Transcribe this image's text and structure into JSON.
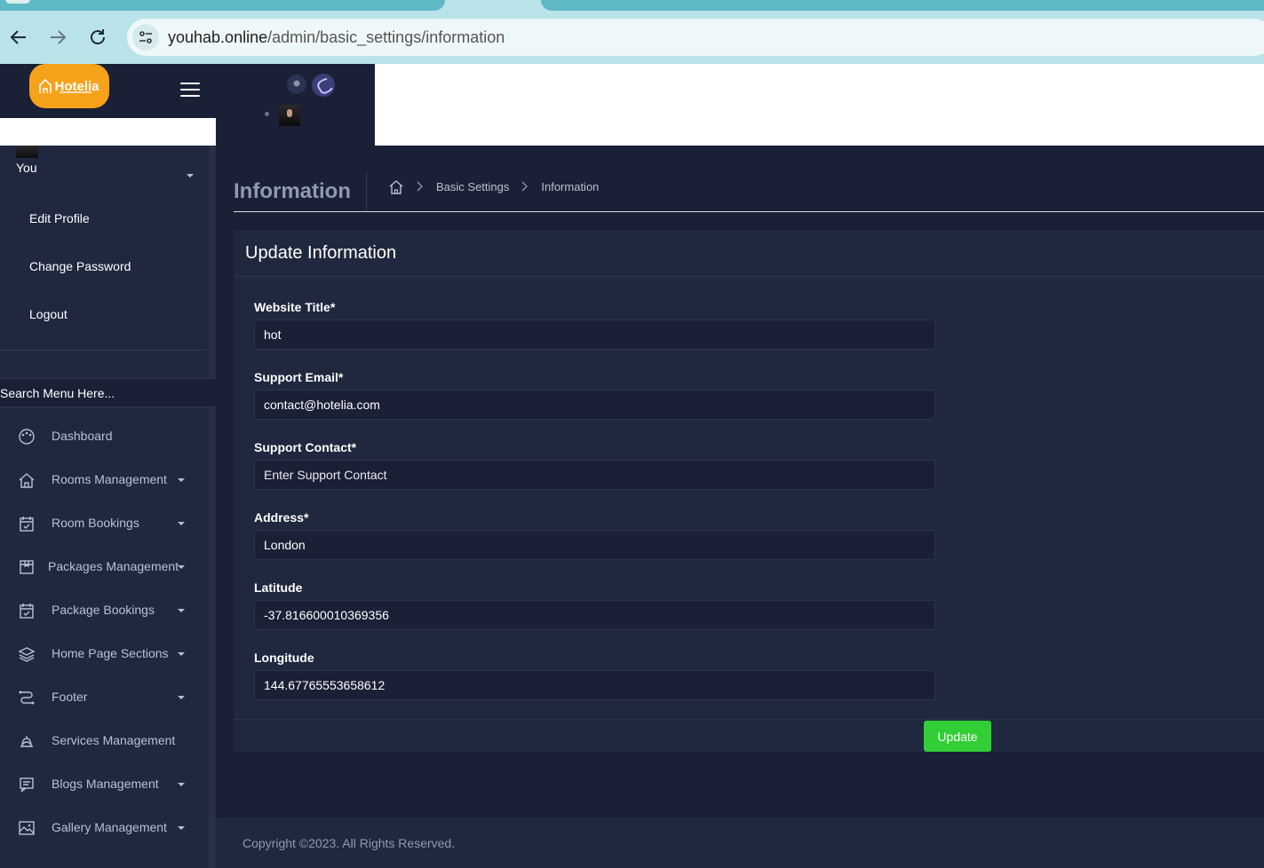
{
  "browser": {
    "url_domain": "youhab.online",
    "url_path": "/admin/basic_settings/information"
  },
  "header": {
    "logo_text": "Hotelia",
    "avatar_alt": "",
    "theme": {
      "light_icon": "sun-icon",
      "dark_icon": "moon-icon"
    }
  },
  "sidebar": {
    "user_name": "You",
    "user_menu": [
      "Edit Profile",
      "Change Password",
      "Logout"
    ],
    "search_placeholder": "Search Menu Here...",
    "items": [
      {
        "label": "Dashboard",
        "icon": "palette-icon",
        "has_caret": false
      },
      {
        "label": "Rooms Management",
        "icon": "home-icon",
        "has_caret": true
      },
      {
        "label": "Room Bookings",
        "icon": "calendar-check-icon",
        "has_caret": true
      },
      {
        "label": "Packages Management",
        "icon": "package-icon",
        "has_caret": true
      },
      {
        "label": "Package Bookings",
        "icon": "calendar-check-icon",
        "has_caret": true
      },
      {
        "label": "Home Page Sections",
        "icon": "layers-icon",
        "has_caret": true
      },
      {
        "label": "Footer",
        "icon": "route-icon",
        "has_caret": true
      },
      {
        "label": "Services Management",
        "icon": "bell-icon",
        "has_caret": false
      },
      {
        "label": "Blogs Management",
        "icon": "blog-icon",
        "has_caret": true
      },
      {
        "label": "Gallery Management",
        "icon": "image-icon",
        "has_caret": true
      }
    ]
  },
  "main": {
    "page_title": "Information",
    "breadcrumb": [
      "Basic Settings",
      "Information"
    ],
    "card_title": "Update Information",
    "fields": {
      "website_title": {
        "label": "Website Title*",
        "value": "hot"
      },
      "support_email": {
        "label": "Support Email*",
        "value": "contact@hotelia.com"
      },
      "support_contact": {
        "label": "Support Contact*",
        "value": "",
        "placeholder": "Enter Support Contact"
      },
      "address": {
        "label": "Address*",
        "value": "London"
      },
      "latitude": {
        "label": "Latitude",
        "value": "-37.816600010369356"
      },
      "longitude": {
        "label": "Longitude",
        "value": "144.67765553658612"
      }
    },
    "update_label": "Update",
    "footer_text": "Copyright ©2023. All Rights Reserved."
  },
  "colors": {
    "background": "#1a2035",
    "sidebar": "#1f283e",
    "logo": "#f7a21b",
    "update_button": "#31ce36"
  }
}
